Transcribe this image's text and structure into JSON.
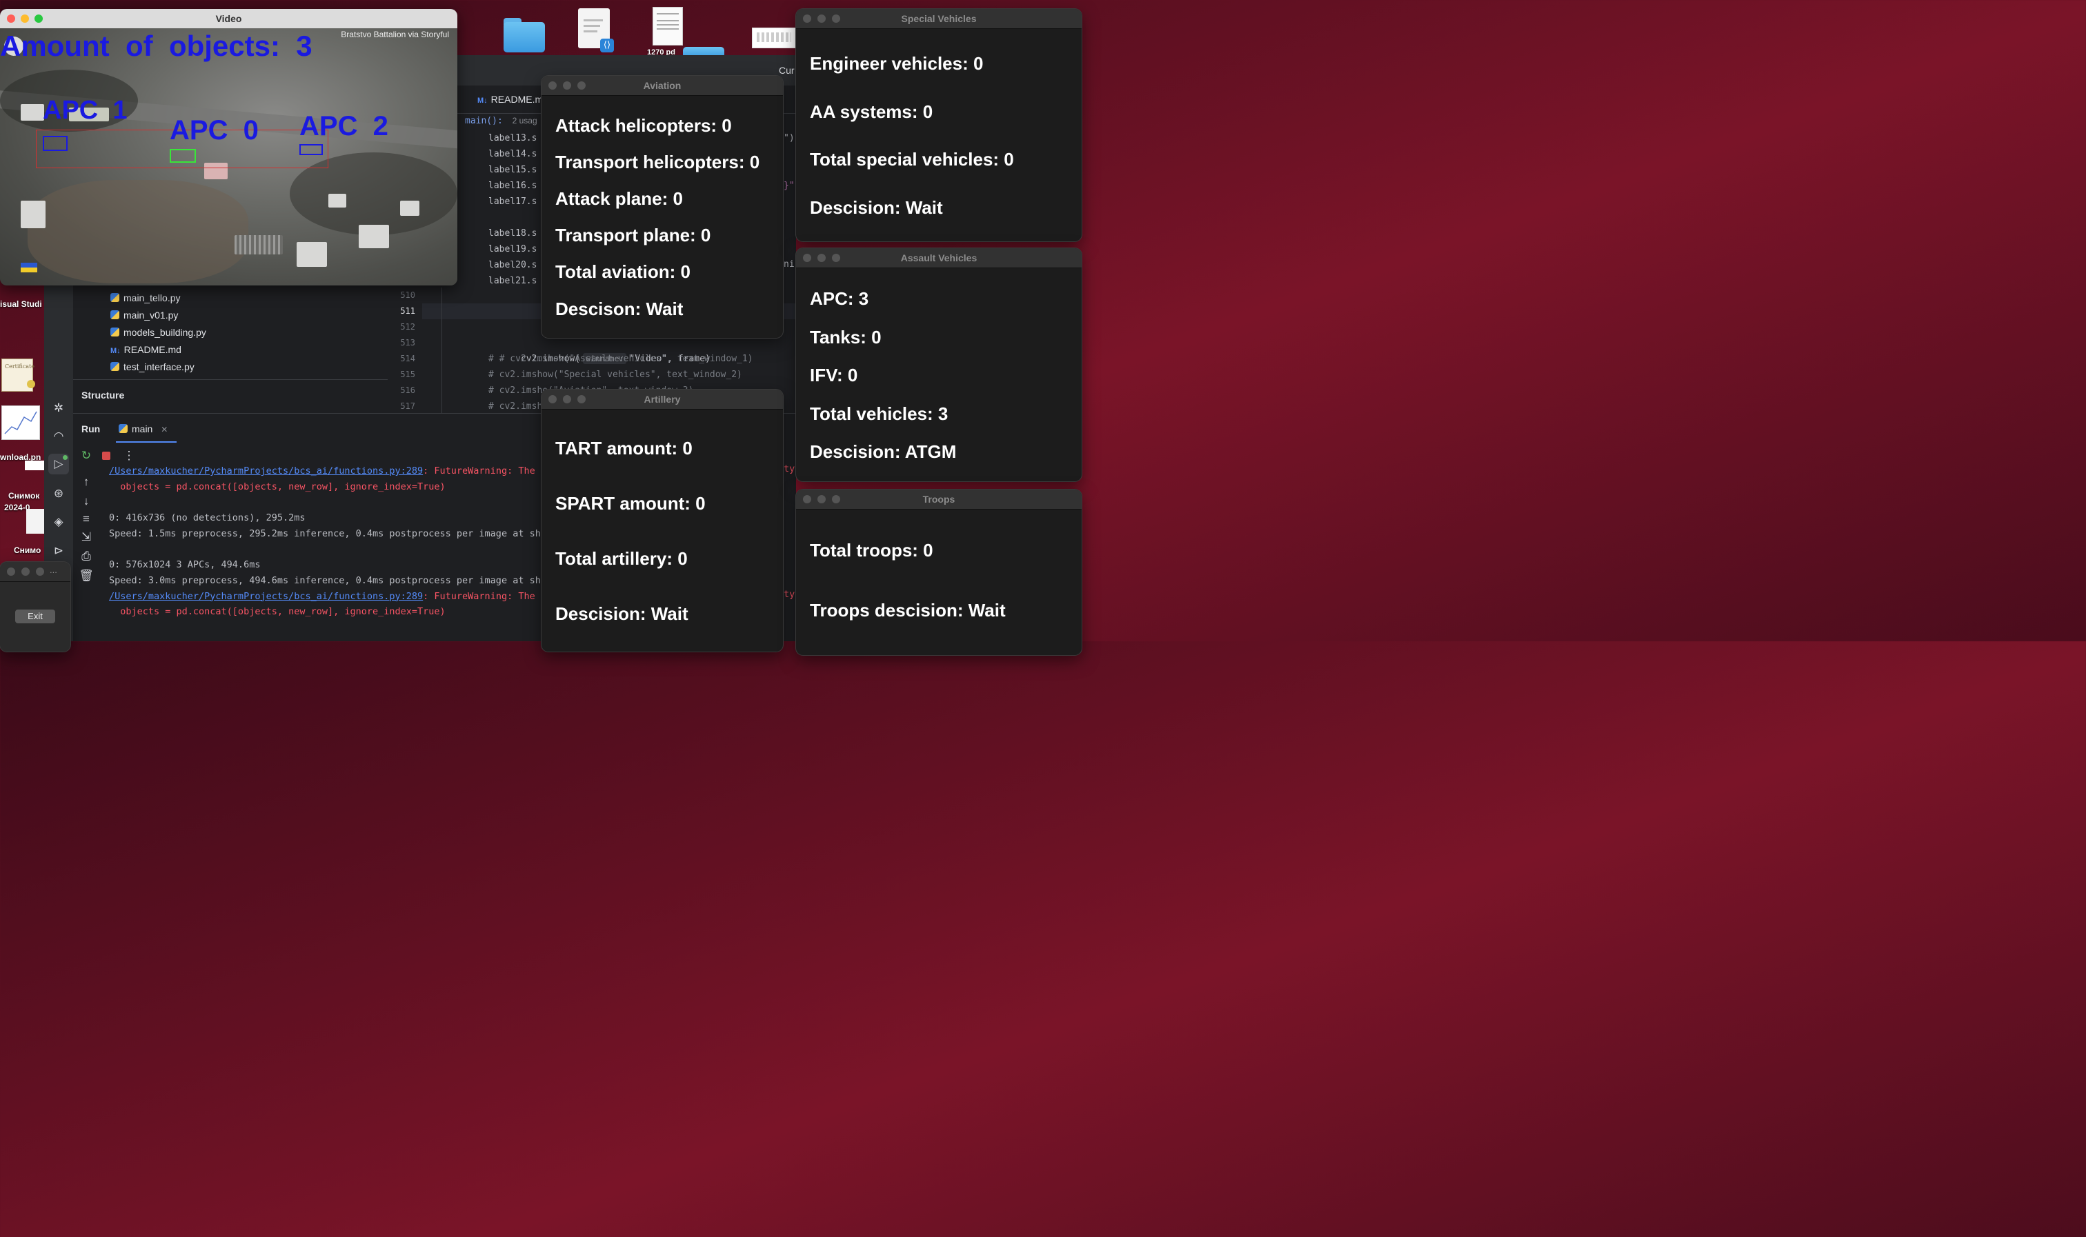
{
  "desktop": {
    "partial_labels": [
      "isual Studi",
      "wnload.pn",
      "Снимок",
      "2024-0",
      "Снимо"
    ]
  },
  "video_window": {
    "title": "Video",
    "overlay_count_text": "Amount  of  objects:  3",
    "watermark": "Bratstvo Battalion via Storyful",
    "detections": [
      "APC  1",
      "APC  0",
      "APC  2"
    ]
  },
  "ide": {
    "tab_readme": "README.m",
    "cur_fragment": "Cur",
    "breadcrumb_fn": "main():",
    "breadcrumb_usages": "2 usag",
    "code_lines": [
      "label13.s",
      "label14.s",
      "label15.s",
      "label16.s",
      "label17.s",
      "",
      "label18.s",
      "label19.s",
      "label20.s",
      "label21.s"
    ],
    "code_right_fragments": [
      "\")",
      "}\"",
      "ni"
    ],
    "gutter": [
      "510",
      "511",
      "512",
      "513",
      "514",
      "515",
      "516",
      "517"
    ],
    "code_below": [
      "cv2.imshow(",
      "# # cv2.imshow(\"Assault vehicles\", text_window_1)",
      "# cv2.imshow(\"Special vehicles\", text_window_2)",
      "# cv2.imsho(\"Aviation\", text_window_3)",
      "# cv2.imsh"
    ],
    "imshow_hint": "winname:",
    "imshow_args": "\"Video\", frame)",
    "project_files": [
      "main_tello.py",
      "main_v01.py",
      "models_building.py",
      "README.md",
      "test_interface.py"
    ],
    "structure_label": "Structure",
    "run_label": "Run",
    "run_tab": "main",
    "console": [
      {
        "text": "/Users/maxkucher/PycharmProjects/bcs_ai/functions.py:289",
        "suffix": ": FutureWarning: The ",
        "tail": "ty"
      },
      {
        "text": "  objects = pd.concat([objects, new_row], ignore_index=True)"
      },
      {
        "text": ""
      },
      {
        "text": "0: 416x736 (no detections), 295.2ms"
      },
      {
        "text": "Speed: 1.5ms preprocess, 295.2ms inference, 0.4ms postprocess per image at sha"
      },
      {
        "text": ""
      },
      {
        "text": "0: 576x1024 3 APCs, 494.6ms"
      },
      {
        "text": "Speed: 3.0ms preprocess, 494.6ms inference, 0.4ms postprocess per image at sha"
      },
      {
        "text": "/Users/maxkucher/PycharmProjects/bcs_ai/functions.py:289",
        "suffix": ": FutureWarning: The ",
        "tail": "ty"
      },
      {
        "text": "  objects = pd.concat([objects, new_row], ignore_index=True)"
      }
    ]
  },
  "aviation": {
    "title": "Aviation",
    "lines": [
      "Attack helicopters: 0",
      "Transport helicopters: 0",
      "Attack plane: 0",
      "Transport plane: 0",
      "Total aviation: 0",
      "Descison: Wait"
    ]
  },
  "artillery": {
    "title": "Artillery",
    "lines": [
      "TART amount: 0",
      "SPART amount: 0",
      "Total artillery: 0",
      "Descision: Wait"
    ]
  },
  "special": {
    "title": "Special Vehicles",
    "lines": [
      "Engineer vehicles: 0",
      "AA systems: 0",
      "Total special vehicles: 0",
      "Descision: Wait"
    ]
  },
  "assault": {
    "title": "Assault Vehicles",
    "lines": [
      "APC: 3",
      "Tanks: 0",
      "IFV: 0",
      "Total vehicles: 3",
      "Descision: ATGM"
    ]
  },
  "troops": {
    "title": "Troops",
    "lines": [
      "Total troops: 0",
      "Troops descision: Wait"
    ]
  },
  "exit_window": {
    "button": "Exit",
    "menu": "..."
  },
  "colors": {
    "detection_blue": "#1a1ae0",
    "detection_green": "#39e639",
    "warning_red": "#f75464",
    "link_blue": "#548af7"
  }
}
